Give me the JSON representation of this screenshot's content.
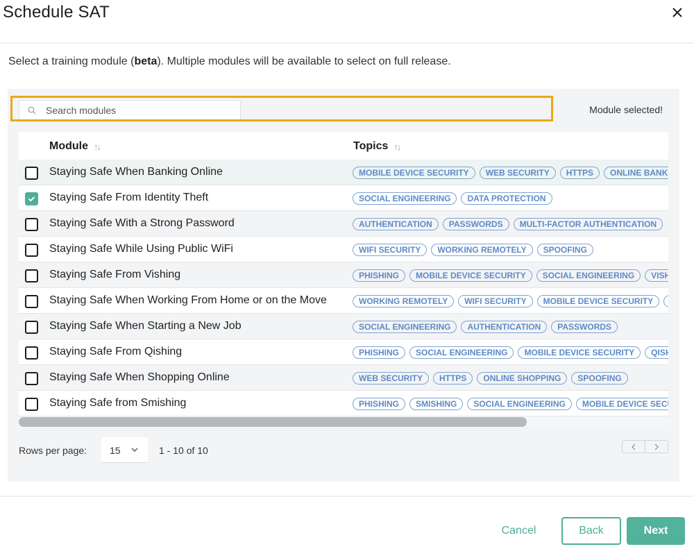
{
  "dialog": {
    "title": "Schedule SAT",
    "close_icon": "close-icon"
  },
  "intro": {
    "before": "Select a training module (",
    "bold": "beta",
    "after": "). Multiple modules will be available to select on full release."
  },
  "search": {
    "placeholder": "Search modules",
    "value": "",
    "icon": "search-icon"
  },
  "status_message": "Module selected!",
  "table": {
    "columns": [
      {
        "label": "Module",
        "sort_icon": "sort-icon"
      },
      {
        "label": "Topics",
        "sort_icon": "sort-icon"
      }
    ],
    "rows": [
      {
        "name": "Staying Safe When Banking Online",
        "checked": false,
        "topics": [
          "MOBILE DEVICE SECURITY",
          "WEB SECURITY",
          "HTTPS",
          "ONLINE BANKI"
        ]
      },
      {
        "name": "Staying Safe From Identity Theft",
        "checked": true,
        "topics": [
          "SOCIAL ENGINEERING",
          "DATA PROTECTION"
        ]
      },
      {
        "name": "Staying Safe With a Strong Password",
        "checked": false,
        "topics": [
          "AUTHENTICATION",
          "PASSWORDS",
          "MULTI-FACTOR AUTHENTICATION"
        ]
      },
      {
        "name": "Staying Safe While Using Public WiFi",
        "checked": false,
        "topics": [
          "WIFI SECURITY",
          "WORKING REMOTELY",
          "SPOOFING"
        ]
      },
      {
        "name": "Staying Safe From Vishing",
        "checked": false,
        "topics": [
          "PHISHING",
          "MOBILE DEVICE SECURITY",
          "SOCIAL ENGINEERING",
          "VISH"
        ]
      },
      {
        "name": "Staying Safe When Working From Home or on the Move",
        "checked": false,
        "topics": [
          "WORKING REMOTELY",
          "WIFI SECURITY",
          "MOBILE DEVICE SECURITY",
          ""
        ]
      },
      {
        "name": "Staying Safe When Starting a New Job",
        "checked": false,
        "topics": [
          "SOCIAL ENGINEERING",
          "AUTHENTICATION",
          "PASSWORDS"
        ]
      },
      {
        "name": "Staying Safe From Qishing",
        "checked": false,
        "topics": [
          "PHISHING",
          "SOCIAL ENGINEERING",
          "MOBILE DEVICE SECURITY",
          "QISH"
        ]
      },
      {
        "name": "Staying Safe When Shopping Online",
        "checked": false,
        "topics": [
          "WEB SECURITY",
          "HTTPS",
          "ONLINE SHOPPING",
          "SPOOFING"
        ]
      },
      {
        "name": "Staying Safe from Smishing",
        "checked": false,
        "topics": [
          "PHISHING",
          "SMISHING",
          "SOCIAL ENGINEERING",
          "MOBILE DEVICE SECU"
        ]
      }
    ]
  },
  "pagination": {
    "rows_per_page_label": "Rows per page:",
    "rows_per_page_value": "15",
    "range_label": "1 - 10 of 10",
    "prev_icon": "chevron-left-icon",
    "next_icon": "chevron-right-icon"
  },
  "footer": {
    "cancel_label": "Cancel",
    "back_label": "Back",
    "next_label": "Next"
  },
  "colors": {
    "accent": "#52b29c",
    "highlight": "#e8a918",
    "pill_text": "#5c8ac6"
  }
}
